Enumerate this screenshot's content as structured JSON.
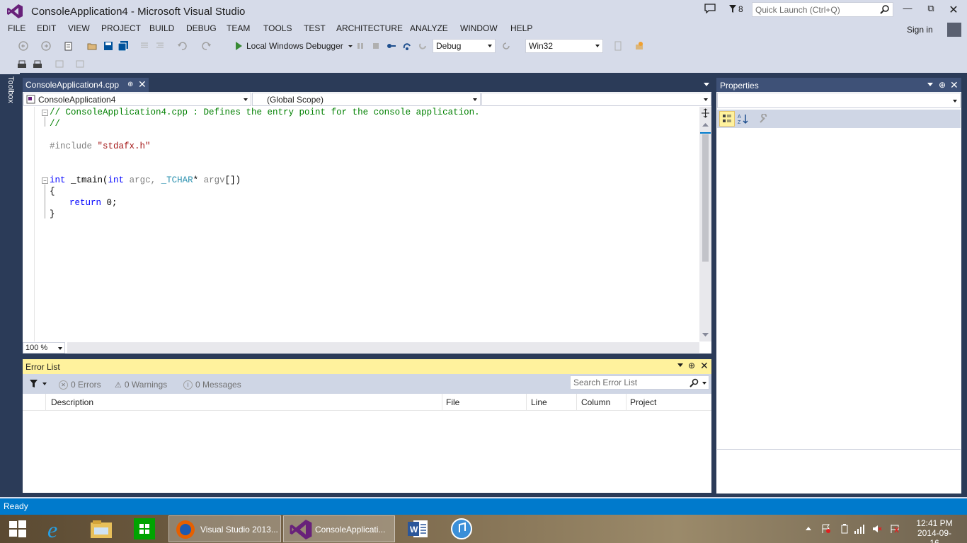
{
  "window": {
    "title": "ConsoleApplication4 - Microsoft Visual Studio",
    "notification_count": "8",
    "quick_launch_placeholder": "Quick Launch (Ctrl+Q)",
    "sign_in": "Sign in"
  },
  "menu": [
    "FILE",
    "EDIT",
    "VIEW",
    "PROJECT",
    "BUILD",
    "DEBUG",
    "TEAM",
    "TOOLS",
    "TEST",
    "ARCHITECTURE",
    "ANALYZE",
    "WINDOW",
    "HELP"
  ],
  "toolbar": {
    "debugger_label": "Local Windows Debugger",
    "configuration": "Debug",
    "platform": "Win32"
  },
  "toolbox_label": "Toolbox",
  "editor": {
    "tab_title": "ConsoleApplication4.cpp",
    "nav_project": "ConsoleApplication4",
    "nav_scope": "(Global Scope)",
    "nav_member": "",
    "zoom": "100 %",
    "code": {
      "line1": "// ConsoleApplication4.cpp : Defines the entry point for the console application.",
      "line2": "//",
      "include_directive": "#include",
      "include_file": "\"stdafx.h\"",
      "kw_int": "int",
      "func_name": "_tmain(",
      "kw_int2": "int",
      "param_argc": "argc,",
      "type_tchar": "_TCHAR",
      "star": "*",
      "param_argv": "argv",
      "close_paren": "[])",
      "open_brace": "{",
      "kw_return": "return",
      "return_value": "0;",
      "close_brace": "}"
    }
  },
  "error_list": {
    "title": "Error List",
    "errors": "0 Errors",
    "warnings": "0 Warnings",
    "messages": "0 Messages",
    "search_placeholder": "Search Error List",
    "columns": [
      "Description",
      "File",
      "Line",
      "Column",
      "Project"
    ]
  },
  "properties": {
    "title": "Properties"
  },
  "status": {
    "text": "Ready"
  },
  "taskbar": {
    "items": [
      "Visual Studio 2013...",
      "ConsoleApplicati..."
    ],
    "time": "12:41 PM",
    "date": "2014-09-16"
  },
  "colors": {
    "accent": "#007acc",
    "panel_header": "#3e5177",
    "background": "#2b3b58",
    "error_header": "#fff29d"
  }
}
